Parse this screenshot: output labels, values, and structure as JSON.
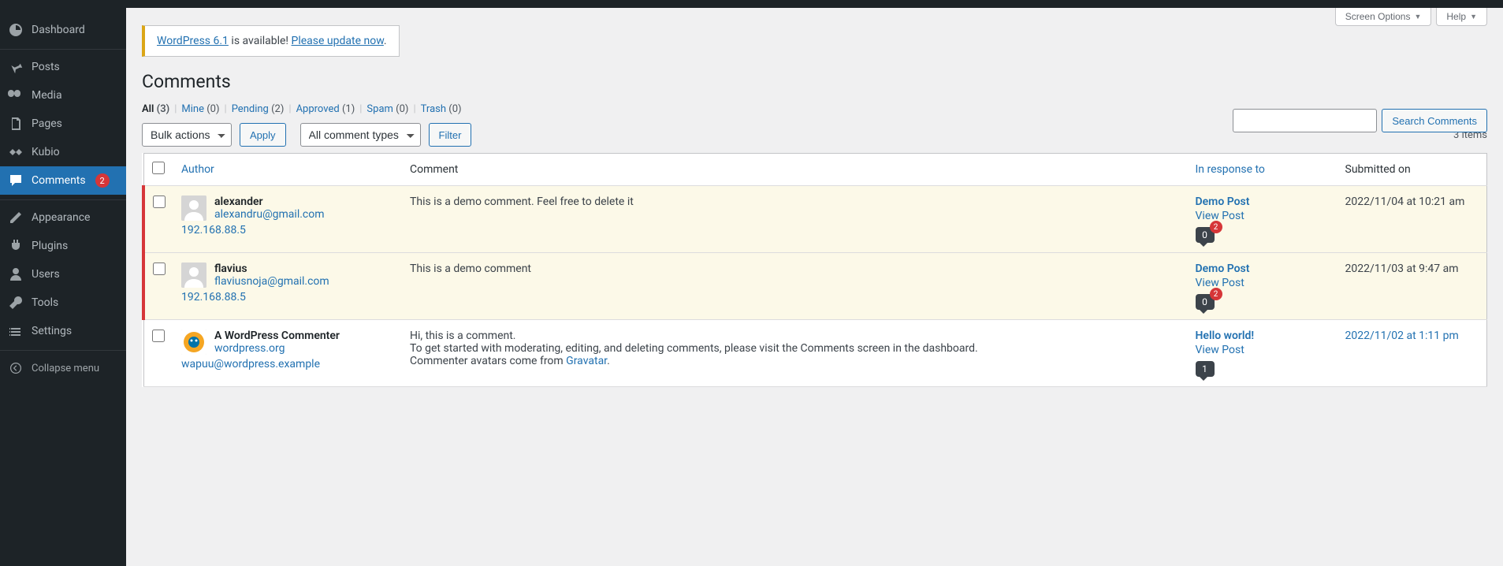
{
  "sidebar": {
    "items": [
      {
        "key": "dashboard",
        "label": "Dashboard"
      },
      {
        "key": "posts",
        "label": "Posts"
      },
      {
        "key": "media",
        "label": "Media"
      },
      {
        "key": "pages",
        "label": "Pages"
      },
      {
        "key": "kubio",
        "label": "Kubio"
      },
      {
        "key": "comments",
        "label": "Comments",
        "badge": "2",
        "active": true
      },
      {
        "key": "appearance",
        "label": "Appearance"
      },
      {
        "key": "plugins",
        "label": "Plugins"
      },
      {
        "key": "users",
        "label": "Users"
      },
      {
        "key": "tools",
        "label": "Tools"
      },
      {
        "key": "settings",
        "label": "Settings"
      }
    ],
    "collapse": "Collapse menu"
  },
  "screen_meta": {
    "options": "Screen Options",
    "help": "Help"
  },
  "notice": {
    "link1": "WordPress 6.1",
    "mid": " is available! ",
    "link2": "Please update now",
    "end": "."
  },
  "page_title": "Comments",
  "filters": {
    "all": {
      "label": "All",
      "count": "(3)"
    },
    "mine": {
      "label": "Mine",
      "count": "(0)"
    },
    "pending": {
      "label": "Pending",
      "count": "(2)"
    },
    "approved": {
      "label": "Approved",
      "count": "(1)"
    },
    "spam": {
      "label": "Spam",
      "count": "(0)"
    },
    "trash": {
      "label": "Trash",
      "count": "(0)"
    }
  },
  "search": {
    "button": "Search Comments",
    "placeholder": ""
  },
  "tablenav": {
    "bulk_select": "Bulk actions",
    "apply": "Apply",
    "type_select": "All comment types",
    "filter": "Filter",
    "count": "3 items"
  },
  "columns": {
    "author": "Author",
    "comment": "Comment",
    "response": "In response to",
    "date": "Submitted on"
  },
  "rows": [
    {
      "pending": true,
      "avatar": "blank",
      "name": "alexander",
      "email": "alexandru@gmail.com",
      "ip": "192.168.88.5",
      "text": "This is a demo comment. Feel free to delete it",
      "post": "Demo Post",
      "view": "View Post",
      "bubble": "0",
      "bubble_badge": "2",
      "date": "2022/11/04 at 10:21 am"
    },
    {
      "pending": true,
      "avatar": "blank",
      "name": "flavius",
      "email": "flaviusnoja@gmail.com",
      "ip": "192.168.88.5",
      "text": "This is a demo comment",
      "post": "Demo Post",
      "view": "View Post",
      "bubble": "0",
      "bubble_badge": "2",
      "date": "2022/11/03 at 9:47 am"
    },
    {
      "pending": false,
      "avatar": "wapuu",
      "name": "A WordPress Commenter",
      "site": "wordpress.org",
      "email": "wapuu@wordpress.example",
      "text_pre": "Hi, this is a comment.",
      "text_mid": "To get started with moderating, editing, and deleting comments, please visit the Comments screen in the dashboard.",
      "text_post_a": "Commenter avatars come from ",
      "text_post_link": "Gravatar",
      "text_post_b": ".",
      "post": "Hello world!",
      "view": "View Post",
      "bubble": "1",
      "date": "2022/11/02 at 1:11 pm"
    }
  ]
}
